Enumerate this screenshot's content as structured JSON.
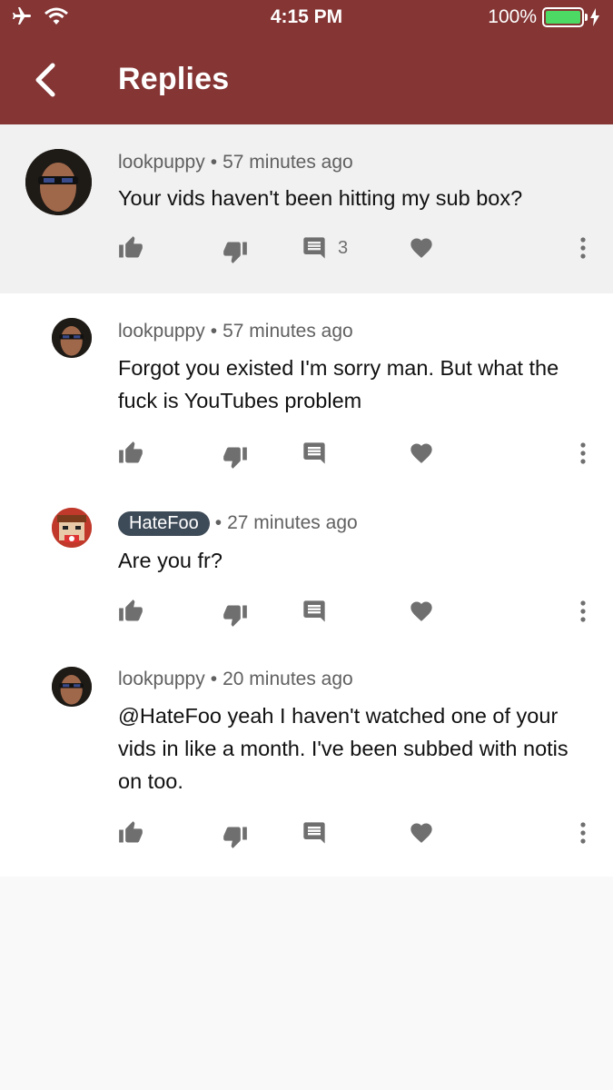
{
  "status_bar": {
    "time": "4:15 PM",
    "battery": "100%"
  },
  "nav": {
    "title": "Replies",
    "back_icon": "chevron-left-icon"
  },
  "colors": {
    "header": "#843534",
    "battery": "#4cd964",
    "badge": "#3d4a57"
  },
  "parent_comment": {
    "author": "lookpuppy",
    "time": "57 minutes ago",
    "text": "Your vids haven't been hitting my sub box?",
    "reply_count": "3"
  },
  "replies": [
    {
      "author": "lookpuppy",
      "time": "57 minutes ago",
      "text": "Forgot you existed I'm sorry man. But what the fuck is YouTubes problem"
    },
    {
      "author": "HateFoo",
      "time": "27 minutes ago",
      "text": "Are you fr?",
      "is_creator": true
    },
    {
      "author": "lookpuppy",
      "time": "20 minutes ago",
      "text": "@HateFoo yeah I haven't watched one of your vids in like a month. I've been subbed with notis on too."
    }
  ],
  "separator": "•"
}
